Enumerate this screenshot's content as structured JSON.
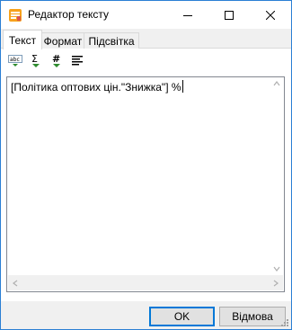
{
  "window": {
    "title": "Редактор тексту",
    "accent": "#0078d7"
  },
  "tabs": [
    {
      "label": "Текст",
      "active": true
    },
    {
      "label": "Формат",
      "active": false
    },
    {
      "label": "Підсвітка",
      "active": false
    }
  ],
  "toolbar": {
    "items": [
      {
        "icon": "spellcheck-icon",
        "label": "abc"
      },
      {
        "icon": "sum-icon",
        "label": "Σ"
      },
      {
        "icon": "number-icon",
        "label": "#"
      },
      {
        "icon": "align-icon"
      }
    ]
  },
  "editor": {
    "value": "[Політика оптових цін.\"Знижка\"] %"
  },
  "buttons": {
    "ok": "OK",
    "cancel": "Відмова"
  }
}
